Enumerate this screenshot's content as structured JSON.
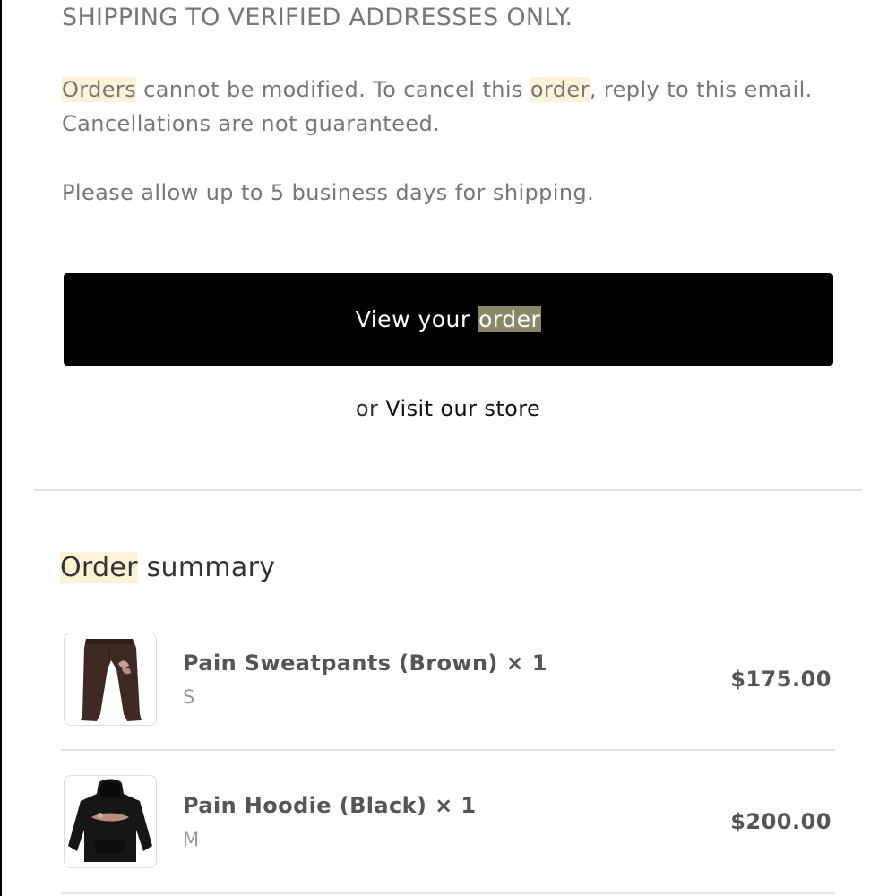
{
  "notice": {
    "shipping_heading": "SHIPPING TO VERIFIED ADDRESSES ONLY.",
    "para1_part1": "Orders",
    "para1_part2": " cannot be modified. To cancel this ",
    "para1_part3": "order",
    "para1_part4": ", reply to this email. Cancellations are not guaranteed.",
    "shipping_time": "Please allow up to 5 business days for shipping."
  },
  "actions": {
    "view_order_prefix": "View your ",
    "view_order_highlight": "order",
    "visit_store_prefix": "or ",
    "visit_store_link": "Visit our store"
  },
  "summary": {
    "title_highlight": "Order",
    "title_rest": " summary",
    "items": [
      {
        "name": "Pain Sweatpants (Brown) × 1",
        "variant": "S",
        "price": "$175.00",
        "thumbnail_icon": "brown-sweatpants-image"
      },
      {
        "name": "Pain Hoodie (Black) × 1",
        "variant": "M",
        "price": "$200.00",
        "thumbnail_icon": "black-hoodie-image"
      }
    ]
  },
  "colors": {
    "button_bg": "#000000",
    "highlight": "#fdf4d8",
    "button_highlight": "#8a8766",
    "muted_text": "#777777"
  }
}
